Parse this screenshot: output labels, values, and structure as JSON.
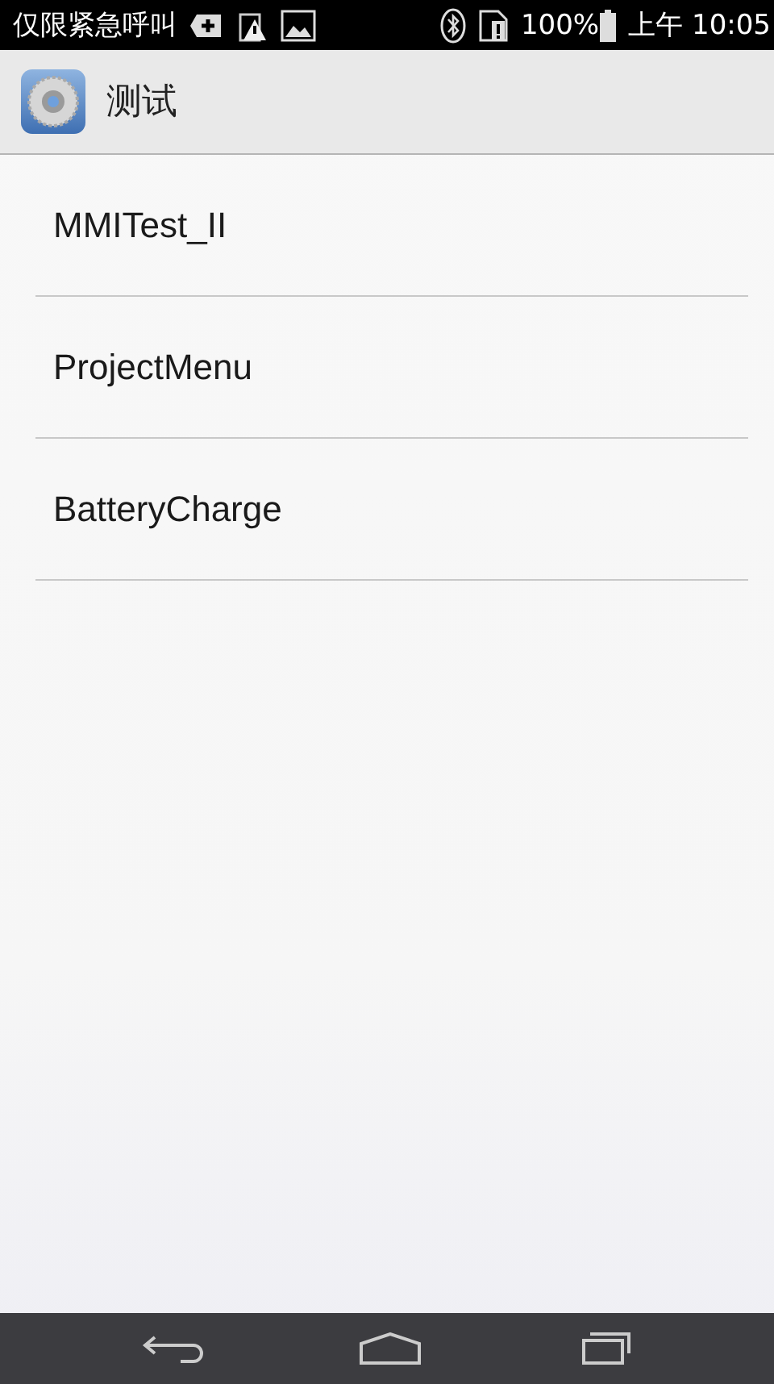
{
  "status_bar": {
    "carrier": "仅限紧急呼叫",
    "battery": "100%",
    "time": "上午 10:05"
  },
  "action_bar": {
    "title": "测试"
  },
  "items": [
    {
      "label": "MMITest_II"
    },
    {
      "label": "ProjectMenu"
    },
    {
      "label": "BatteryCharge"
    }
  ]
}
